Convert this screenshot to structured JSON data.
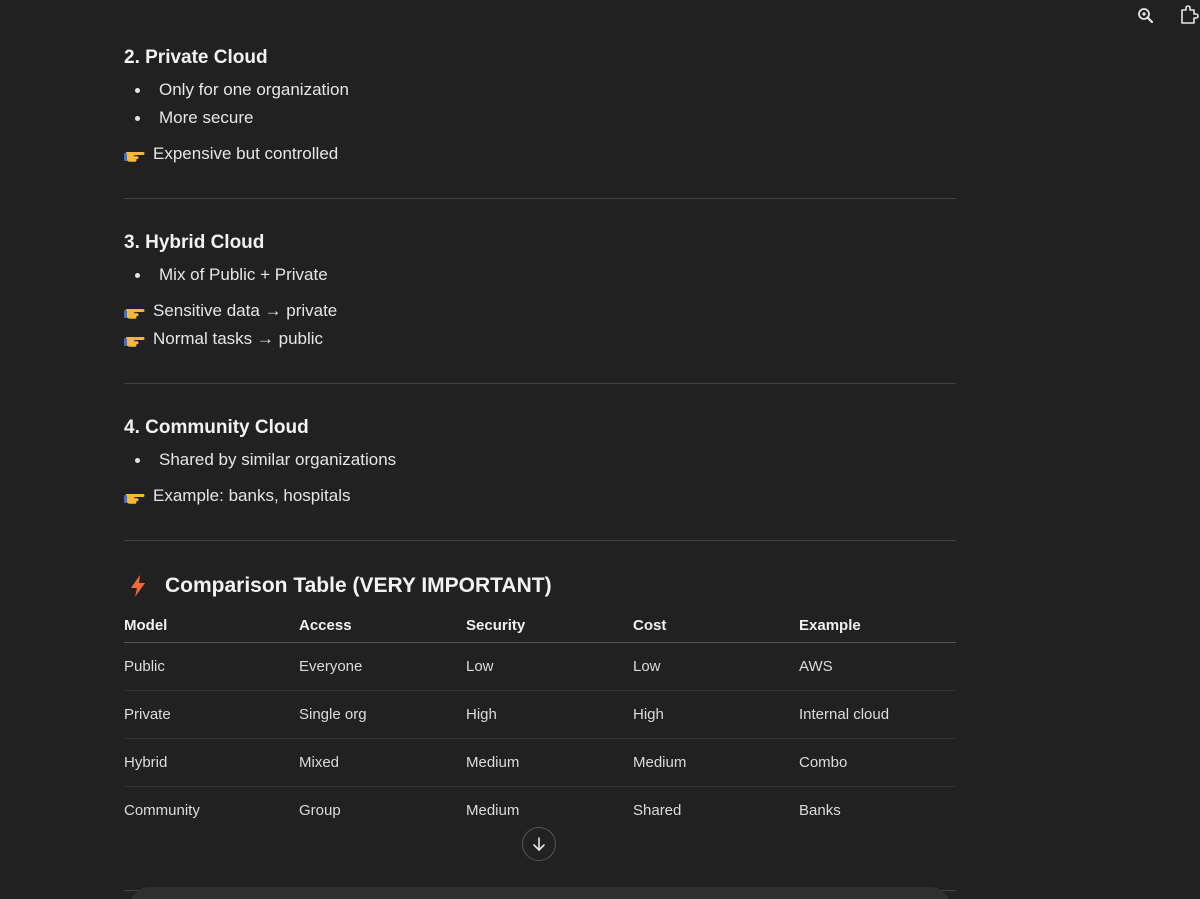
{
  "toolbar": {
    "icons": [
      "zoom-icon",
      "extension-icon"
    ]
  },
  "sections": [
    {
      "title": "2. Private Cloud",
      "bullets": [
        "Only for one organization",
        "More secure"
      ],
      "notes": [
        "Expensive but controlled"
      ]
    },
    {
      "title": "3. Hybrid Cloud",
      "bullets": [
        "Mix of Public + Private"
      ],
      "notes": [
        "Sensitive data → private",
        "Normal tasks → public"
      ]
    },
    {
      "title": "4. Community Cloud",
      "bullets": [
        "Shared by similar organizations"
      ],
      "notes": [
        "Example: banks, hospitals"
      ]
    }
  ],
  "comparison": {
    "title": "Comparison Table (VERY IMPORTANT)",
    "headers": [
      "Model",
      "Access",
      "Security",
      "Cost",
      "Example"
    ],
    "rows": [
      [
        "Public",
        "Everyone",
        "Low",
        "Low",
        "AWS"
      ],
      [
        "Private",
        "Single org",
        "High",
        "High",
        "Internal cloud"
      ],
      [
        "Hybrid",
        "Mixed",
        "Medium",
        "Medium",
        "Combo"
      ],
      [
        "Community",
        "Group",
        "Medium",
        "Shared",
        "Banks"
      ]
    ]
  },
  "colors": {
    "background": "#212121",
    "text": "#ececec",
    "divider": "#444444",
    "bolt": "#f26a36",
    "pointing_hand": "#f5b83d"
  }
}
